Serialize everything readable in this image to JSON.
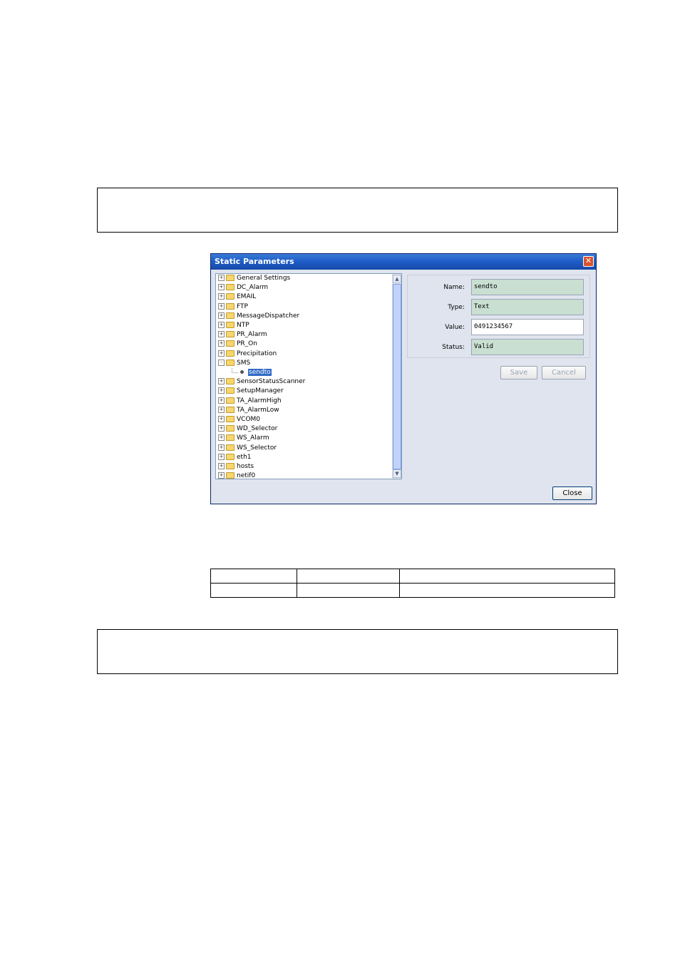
{
  "dialog": {
    "title": "Static Parameters",
    "tree": [
      {
        "label": "General Settings",
        "expand": "+",
        "type": "folder"
      },
      {
        "label": "DC_Alarm",
        "expand": "+",
        "type": "folder"
      },
      {
        "label": "EMAIL",
        "expand": "+",
        "type": "folder"
      },
      {
        "label": "FTP",
        "expand": "+",
        "type": "folder"
      },
      {
        "label": "MessageDispatcher",
        "expand": "+",
        "type": "folder"
      },
      {
        "label": "NTP",
        "expand": "+",
        "type": "folder"
      },
      {
        "label": "PR_Alarm",
        "expand": "+",
        "type": "folder"
      },
      {
        "label": "PR_On",
        "expand": "+",
        "type": "folder"
      },
      {
        "label": "Precipitation",
        "expand": "+",
        "type": "folder"
      },
      {
        "label": "SMS",
        "expand": "-",
        "type": "folder"
      },
      {
        "label": "sendto",
        "type": "leaf",
        "selected": true
      },
      {
        "label": "SensorStatusScanner",
        "expand": "+",
        "type": "folder"
      },
      {
        "label": "SetupManager",
        "expand": "+",
        "type": "folder"
      },
      {
        "label": "TA_AlarmHigh",
        "expand": "+",
        "type": "folder"
      },
      {
        "label": "TA_AlarmLow",
        "expand": "+",
        "type": "folder"
      },
      {
        "label": "VCOM0",
        "expand": "+",
        "type": "folder"
      },
      {
        "label": "WD_Selector",
        "expand": "+",
        "type": "folder"
      },
      {
        "label": "WS_Alarm",
        "expand": "+",
        "type": "folder"
      },
      {
        "label": "WS_Selector",
        "expand": "+",
        "type": "folder"
      },
      {
        "label": "eth1",
        "expand": "+",
        "type": "folder"
      },
      {
        "label": "hosts",
        "expand": "+",
        "type": "folder"
      },
      {
        "label": "netif0",
        "expand": "+",
        "type": "folder"
      }
    ],
    "props": {
      "name_label": "Name:",
      "name_value": "sendto",
      "type_label": "Type:",
      "type_value": "Text",
      "value_label": "Value:",
      "value_value": "0491234567",
      "status_label": "Status:",
      "status_value": "Valid"
    },
    "buttons": {
      "save": "Save",
      "cancel": "Cancel",
      "close": "Close"
    },
    "close_glyph": "✕"
  },
  "icons": {
    "scroll_up": "▲",
    "scroll_down": "▼",
    "folder": "folder-icon",
    "close": "close-icon"
  }
}
